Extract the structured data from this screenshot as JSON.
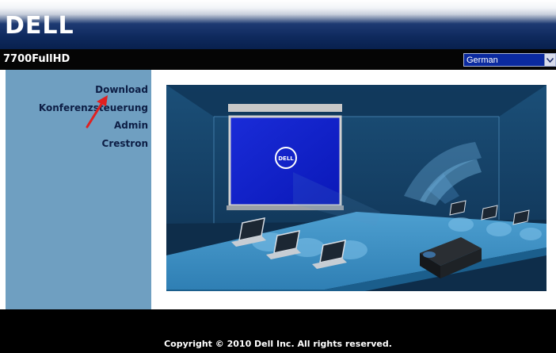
{
  "header": {
    "logo_icon": "dell-logo",
    "logo_text": "DELL"
  },
  "titlebar": {
    "model": "7700FullHD",
    "language_selected": "German"
  },
  "nav": {
    "items": [
      {
        "label": "Download"
      },
      {
        "label": "Konferenzsteuerung"
      },
      {
        "label": "Admin"
      },
      {
        "label": "Crestron"
      }
    ]
  },
  "annotation": {
    "icon": "red-arrow-icon",
    "color": "#e02020"
  },
  "content": {
    "illustration_icon": "conference-room-illustration",
    "screen_logo": "DELL"
  },
  "footer": {
    "copyright": "Copyright © 2010 Dell Inc. All rights reserved."
  },
  "colors": {
    "header_blue": "#0f2a5e",
    "sidebar": "#6f9fc1",
    "select_bg": "#0b2aa0",
    "black_bar": "#050505"
  }
}
